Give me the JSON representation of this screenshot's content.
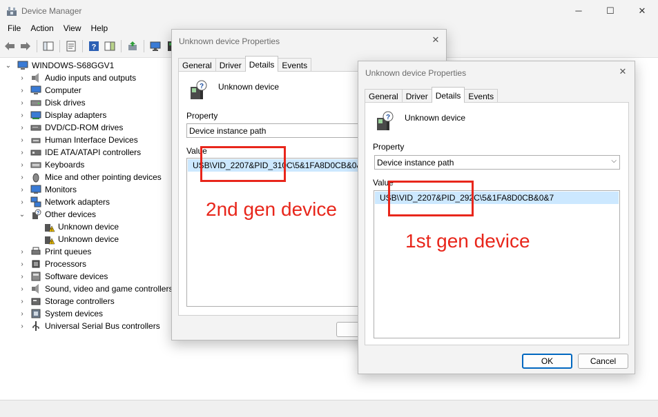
{
  "window": {
    "title": "Device Manager"
  },
  "menu": [
    "File",
    "Action",
    "View",
    "Help"
  ],
  "tree": {
    "root": "WINDOWS-S68GGV1",
    "items": [
      "Audio inputs and outputs",
      "Computer",
      "Disk drives",
      "Display adapters",
      "DVD/CD-ROM drives",
      "Human Interface Devices",
      "IDE ATA/ATAPI controllers",
      "Keyboards",
      "Mice and other pointing devices",
      "Monitors",
      "Network adapters",
      "Other devices",
      "Unknown device",
      "Unknown device",
      "Print queues",
      "Processors",
      "Software devices",
      "Sound, video and game controllers",
      "Storage controllers",
      "System devices",
      "Universal Serial Bus controllers"
    ]
  },
  "dialog_back": {
    "title": "Unknown device Properties",
    "tabs": [
      "General",
      "Driver",
      "Details",
      "Events"
    ],
    "active_tab": "Details",
    "device_name": "Unknown device",
    "property_label": "Property",
    "property_value": "Device instance path",
    "value_label": "Value",
    "value_item": "USB\\VID_2207&PID_310C\\5&1FA8D0CB&0&6",
    "ok_partial": "O"
  },
  "dialog_front": {
    "title": "Unknown device Properties",
    "tabs": [
      "General",
      "Driver",
      "Details",
      "Events"
    ],
    "active_tab": "Details",
    "device_name": "Unknown device",
    "property_label": "Property",
    "property_value": "Device instance path",
    "value_label": "Value",
    "value_item": "USB\\VID_2207&PID_292C\\5&1FA8D0CB&0&7",
    "ok_label": "OK",
    "cancel_label": "Cancel"
  },
  "annotations": {
    "second_gen": "2nd gen device",
    "first_gen": "1st gen device",
    "color": "#e8261b"
  },
  "colors": {
    "selection": "#cce8ff",
    "accent": "#0067c0"
  }
}
